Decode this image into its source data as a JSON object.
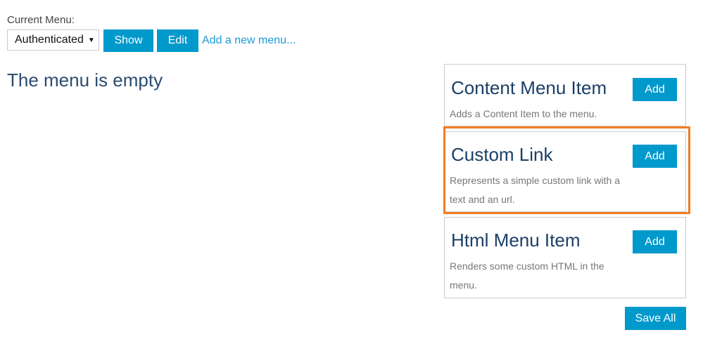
{
  "header": {
    "current_menu_label": "Current Menu:",
    "selected_menu": "Authenticated",
    "show_label": "Show",
    "edit_label": "Edit",
    "add_menu_link": "Add a new menu..."
  },
  "main": {
    "empty_message": "The menu is empty"
  },
  "menu_item_types": [
    {
      "title": "Content Menu Item",
      "description": "Adds a Content Item to the menu.",
      "add_label": "Add"
    },
    {
      "title": "Custom Link",
      "description": "Represents a simple custom link with a text and an url.",
      "add_label": "Add",
      "highlighted": true
    },
    {
      "title": "Html Menu Item",
      "description": "Renders some custom HTML in the menu.",
      "add_label": "Add"
    }
  ],
  "footer": {
    "save_all_label": "Save All"
  },
  "colors": {
    "accent": "#0099cc",
    "highlight": "#f57c20",
    "link": "#1e9bd7"
  }
}
